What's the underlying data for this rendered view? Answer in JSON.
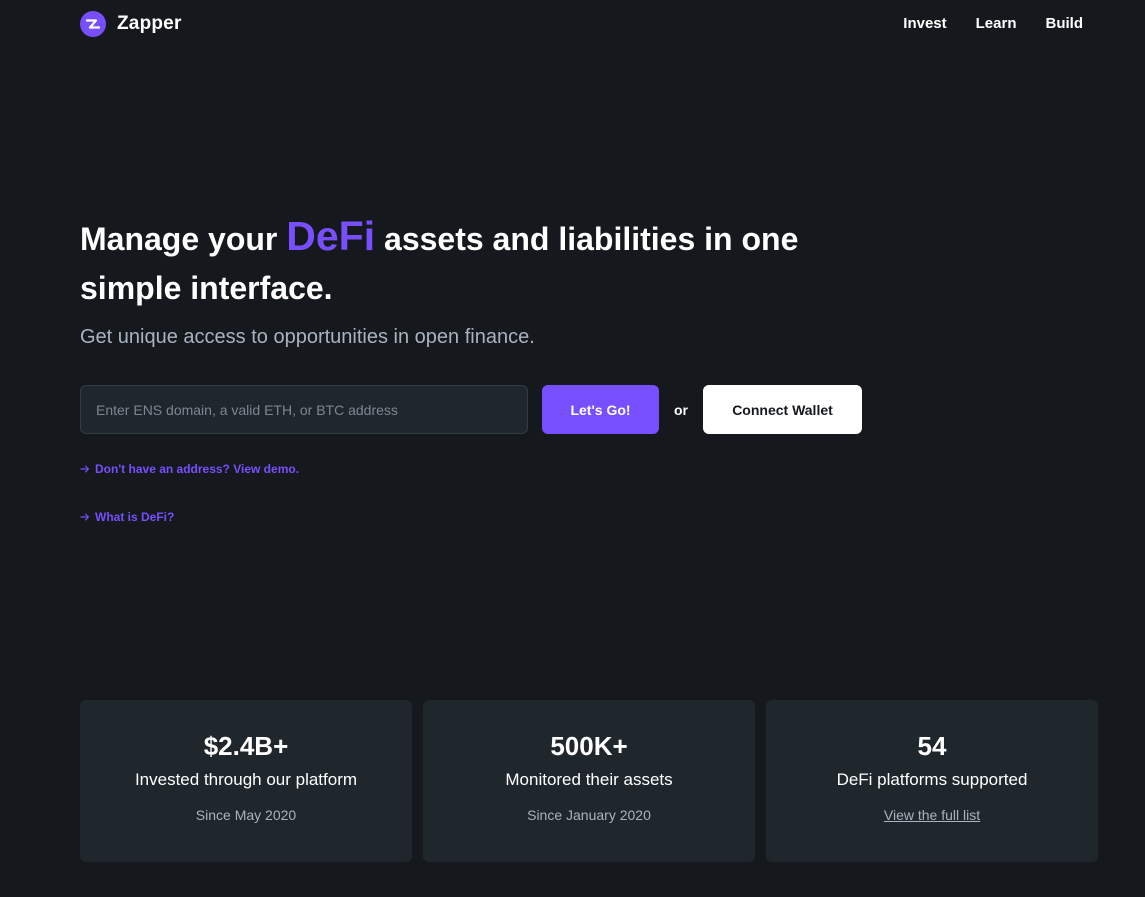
{
  "brand": {
    "name": "Zapper",
    "accent_color": "#784ffe",
    "background_color": "#15181c",
    "logo_icon": "zapper-logo-icon"
  },
  "nav": {
    "items": [
      "Invest",
      "Learn",
      "Build"
    ]
  },
  "hero": {
    "headline_before": "Manage your ",
    "headline_accent": "DeFi",
    "headline_after": " assets and liabilities in one simple interface.",
    "subheadline": "Get unique access to opportunities in open finance."
  },
  "search": {
    "placeholder": "Enter ENS domain, a valid ETH, or BTC address",
    "value": "",
    "go_label": "Let's Go!",
    "or_label": "or",
    "connect_label": "Connect Wallet"
  },
  "links": {
    "demo": "Don't have an address? View demo.",
    "what_is_defi": "What is DeFi?",
    "arrow_icon": "arrow-right-icon"
  },
  "stats": [
    {
      "value": "$2.4B+",
      "label": "Invested through our platform",
      "since": "Since May 2020"
    },
    {
      "value": "500K+",
      "label": "Monitored their assets",
      "since": "Since January 2020"
    },
    {
      "value": "54",
      "label": "DeFi platforms supported",
      "since": "View the full list"
    }
  ]
}
